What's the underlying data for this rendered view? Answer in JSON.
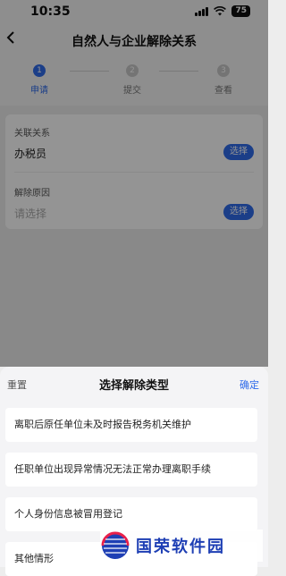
{
  "status_bar": {
    "time": "10:35",
    "battery": "75"
  },
  "header": {
    "title": "自然人与企业解除关系",
    "back_icon": "chevron-left-icon"
  },
  "steps": [
    {
      "num": "1",
      "label": "申请",
      "active": true
    },
    {
      "num": "2",
      "label": "提交",
      "active": false
    },
    {
      "num": "3",
      "label": "查看",
      "active": false
    }
  ],
  "form": {
    "relation": {
      "label": "关联关系",
      "value": "办税员",
      "button": "选择"
    },
    "reason": {
      "label": "解除原因",
      "placeholder": "请选择",
      "button": "选择"
    }
  },
  "sheet": {
    "reset": "重置",
    "title": "选择解除类型",
    "confirm": "确定",
    "options": [
      "离职后原任单位未及时报告税务机关维护",
      "任职单位出现异常情况无法正常办理离职手续",
      "个人身份信息被冒用登记",
      "其他情形"
    ]
  },
  "watermark": {
    "text": "国荣软件园"
  },
  "colors": {
    "accent": "#2f6bea",
    "overlay": "rgba(0,0,0,0.42)",
    "watermark": "#1e3fb4"
  }
}
